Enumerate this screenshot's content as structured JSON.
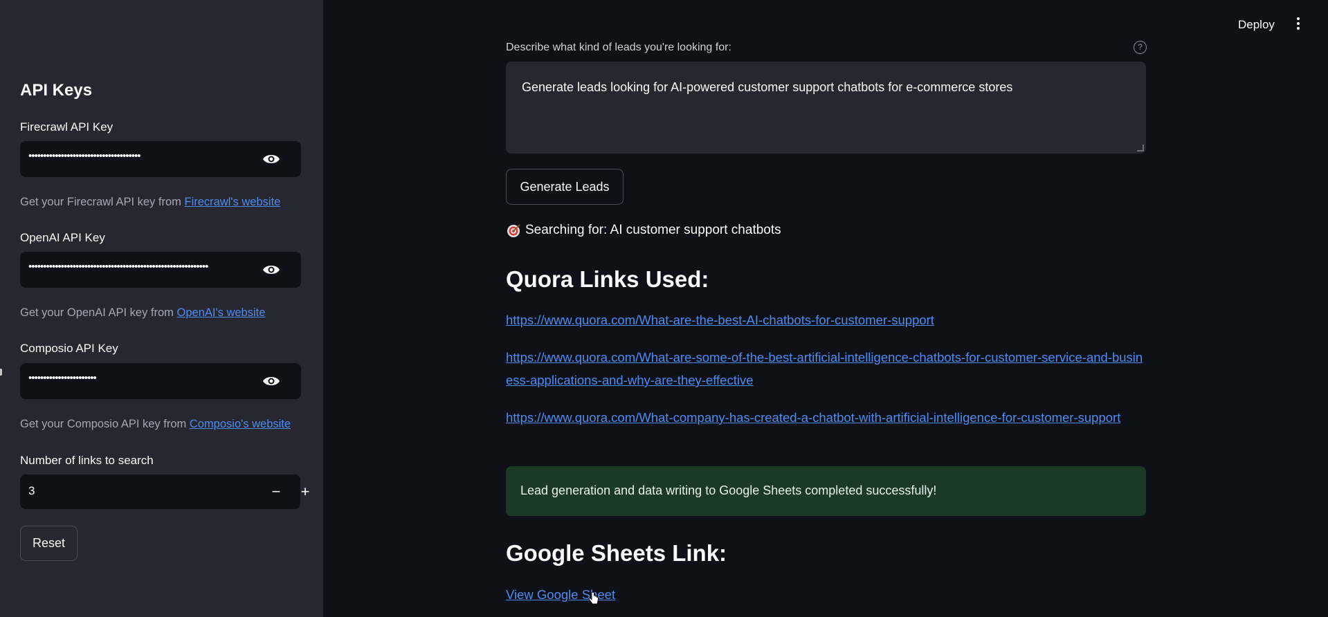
{
  "header": {
    "deploy_label": "Deploy",
    "menu_icon": "kebab-menu-icon"
  },
  "sidebar": {
    "title": "API Keys",
    "firecrawl": {
      "label": "Firecrawl API Key",
      "value": "••••••••••••••••••••••••••••••••••••••",
      "help_prefix": "Get your Firecrawl API key from ",
      "help_link": "Firecrawl's website"
    },
    "openai": {
      "label": "OpenAI API Key",
      "value": "•••••••••••••••••••••••••••••••••••••••••••••••••••••••••••••",
      "help_prefix": "Get your OpenAI API key from ",
      "help_link": "OpenAI's website"
    },
    "composio": {
      "label": "Composio API Key",
      "value": "•••••••••••••••••••••••",
      "help_prefix": "Get your Composio API key from ",
      "help_link": "Composio's website"
    },
    "links_count": {
      "label": "Number of links to search",
      "value": "3",
      "minus": "−",
      "plus": "+"
    },
    "reset_label": "Reset"
  },
  "main": {
    "prompt_label": "Describe what kind of leads you're looking for:",
    "help_glyph": "?",
    "prompt_value": "Generate leads looking for AI-powered customer support chatbots for e-commerce stores",
    "generate_label": "Generate Leads",
    "searching_text": "Searching for: AI customer support chatbots",
    "quora_heading": "Quora Links Used:",
    "quora_links": [
      "https://www.quora.com/What-are-the-best-AI-chatbots-for-customer-support",
      "https://www.quora.com/What-are-some-of-the-best-artificial-intelligence-chatbots-for-customer-service-and-business-applications-and-why-are-they-effective",
      "https://www.quora.com/What-company-has-created-a-chatbot-with-artificial-intelligence-for-customer-support"
    ],
    "success_message": "Lead generation and data writing to Google Sheets completed successfully!",
    "sheets_heading": "Google Sheets Link:",
    "sheets_link": "View Google Sheet"
  },
  "colors": {
    "background": "#0e1117",
    "sidebar": "#262730",
    "link": "#4e8cf0",
    "success_bg": "#1a3a26"
  }
}
